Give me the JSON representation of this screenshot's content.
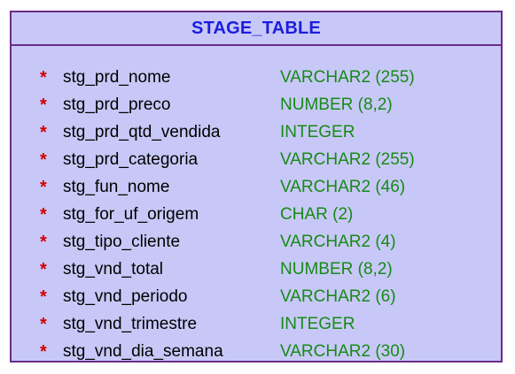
{
  "entity": {
    "title": "STAGE_TABLE",
    "required_marker": "*",
    "colors": {
      "fill": "#c8c8f8",
      "border": "#6a2c86",
      "title": "#1c1ce0",
      "required": "#d10000",
      "name": "#000000",
      "type": "#168a16"
    },
    "columns": [
      {
        "name": "stg_prd_nome",
        "type": "VARCHAR2 (255)"
      },
      {
        "name": "stg_prd_preco",
        "type": "NUMBER (8,2)"
      },
      {
        "name": "stg_prd_qtd_vendida",
        "type": "INTEGER"
      },
      {
        "name": "stg_prd_categoria",
        "type": "VARCHAR2 (255)"
      },
      {
        "name": "stg_fun_nome",
        "type": "VARCHAR2 (46)"
      },
      {
        "name": "stg_for_uf_origem",
        "type": "CHAR (2)"
      },
      {
        "name": "stg_tipo_cliente",
        "type": "VARCHAR2 (4)"
      },
      {
        "name": "stg_vnd_total",
        "type": "NUMBER (8,2)"
      },
      {
        "name": "stg_vnd_periodo",
        "type": "VARCHAR2 (6)"
      },
      {
        "name": "stg_vnd_trimestre",
        "type": "INTEGER"
      },
      {
        "name": "stg_vnd_dia_semana",
        "type": "VARCHAR2 (30)"
      }
    ]
  }
}
